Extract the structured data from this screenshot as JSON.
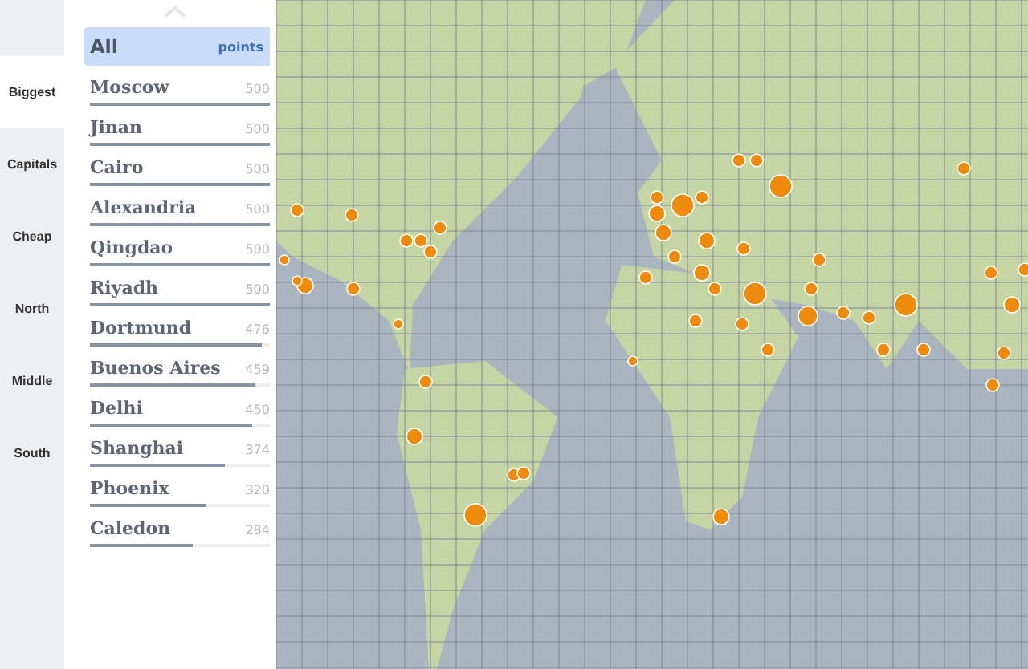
{
  "tabs": [
    {
      "label": "Biggest",
      "selected": true
    },
    {
      "label": "Capitals",
      "selected": false
    },
    {
      "label": "Cheap",
      "selected": false
    },
    {
      "label": "North",
      "selected": false
    },
    {
      "label": "Middle",
      "selected": false
    },
    {
      "label": "South",
      "selected": false
    }
  ],
  "list": {
    "header": {
      "label": "All",
      "unit": "points",
      "selected": true
    },
    "rows": [
      {
        "name": "Moscow",
        "value": "500",
        "level": 1
      },
      {
        "name": "Jinan",
        "value": "500",
        "level": 1
      },
      {
        "name": "Cairo",
        "value": "500",
        "level": 1
      },
      {
        "name": "Alexandria",
        "value": "500",
        "level": 1
      },
      {
        "name": "Qingdao",
        "value": "500",
        "level": 1
      },
      {
        "name": "Riyadh",
        "value": "500",
        "level": 1
      },
      {
        "name": "Dortmund",
        "value": "476",
        "level": 0.952
      },
      {
        "name": "Buenos Aires",
        "value": "459",
        "level": 0.918
      },
      {
        "name": "Delhi",
        "value": "450",
        "level": 0.9
      },
      {
        "name": "Shanghai",
        "value": "374",
        "level": 0.748
      },
      {
        "name": "Phoenix",
        "value": "320",
        "level": 0.64
      },
      {
        "name": "Caledon",
        "value": "284",
        "level": 0.568
      }
    ]
  }
}
